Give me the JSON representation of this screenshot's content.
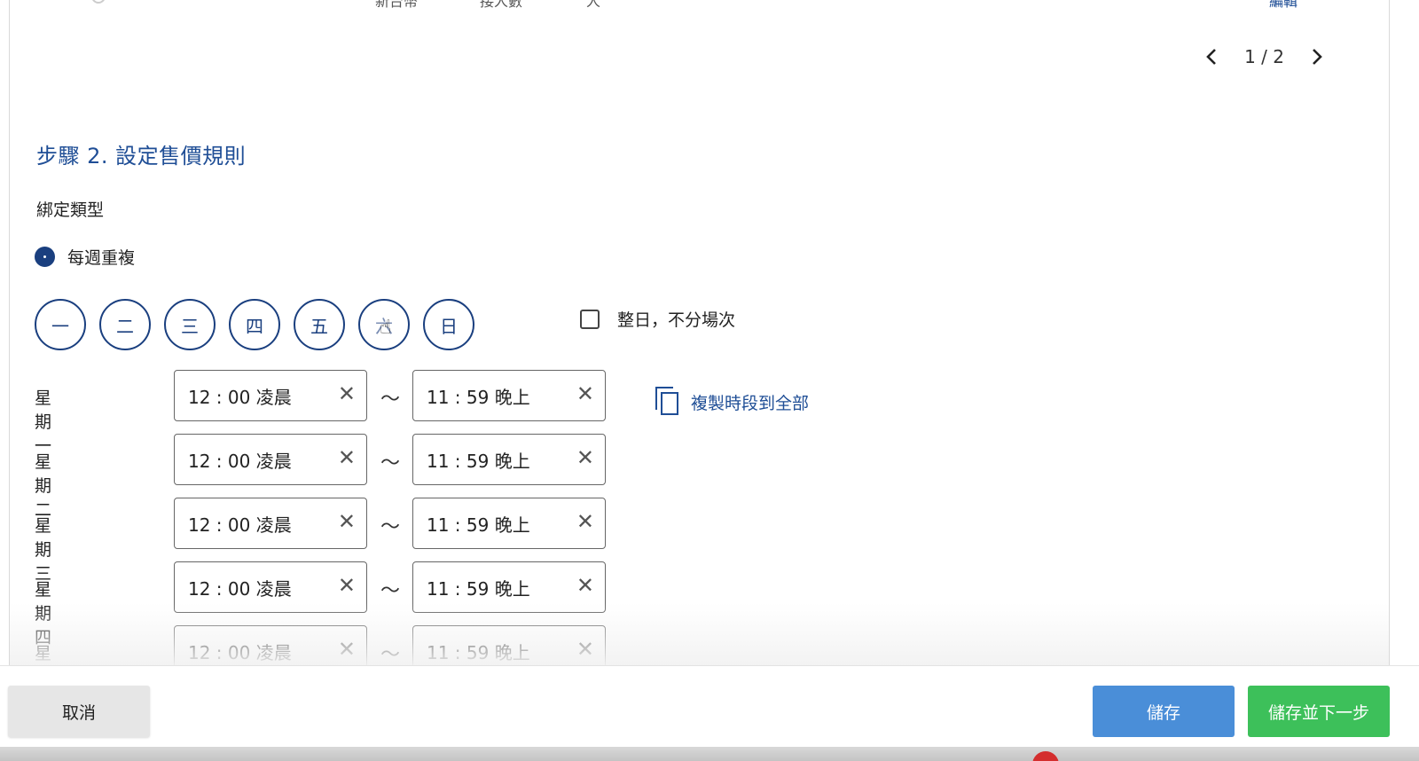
{
  "header_cut_row": {
    "col1": "新台幣",
    "col2": "接人數",
    "col3": "人",
    "edit_label": "編輯"
  },
  "pager": {
    "current": "1",
    "separator": "/",
    "total": "2"
  },
  "step": {
    "title": "步驟 2. 設定售價規則"
  },
  "binding": {
    "label": "綁定類型",
    "option": "每週重複",
    "option_checked": true
  },
  "weekdays": [
    {
      "label": "一"
    },
    {
      "label": "二"
    },
    {
      "label": "三"
    },
    {
      "label": "四"
    },
    {
      "label": "五"
    },
    {
      "label": "六"
    },
    {
      "label": "日"
    }
  ],
  "all_day": {
    "label": "整日，不分場次",
    "checked": false
  },
  "copy_all": {
    "label": "複製時段到全部",
    "icon": "copy-icon"
  },
  "tilde": "～",
  "schedule": [
    {
      "day": "星期一",
      "start": "12 : 00 凌晨",
      "end": "11 : 59 晚上"
    },
    {
      "day": "星期二",
      "start": "12 : 00 凌晨",
      "end": "11 : 59 晚上"
    },
    {
      "day": "星期三",
      "start": "12 : 00 凌晨",
      "end": "11 : 59 晚上"
    },
    {
      "day": "星期四",
      "start": "12 : 00 凌晨",
      "end": "11 : 59 晚上"
    },
    {
      "day": "星期五",
      "start": "12 : 00 凌晨",
      "end": "11 : 59 晚上"
    }
  ],
  "clear_glyph": "✕",
  "footer": {
    "cancel": "取消",
    "save": "儲存",
    "save_next": "儲存並下一步"
  },
  "colors": {
    "primary": "#1a3f7f",
    "link": "#1f4e96",
    "save": "#4a8ed8",
    "save_next": "#3dc05a",
    "cancel": "#e6e6e6"
  }
}
